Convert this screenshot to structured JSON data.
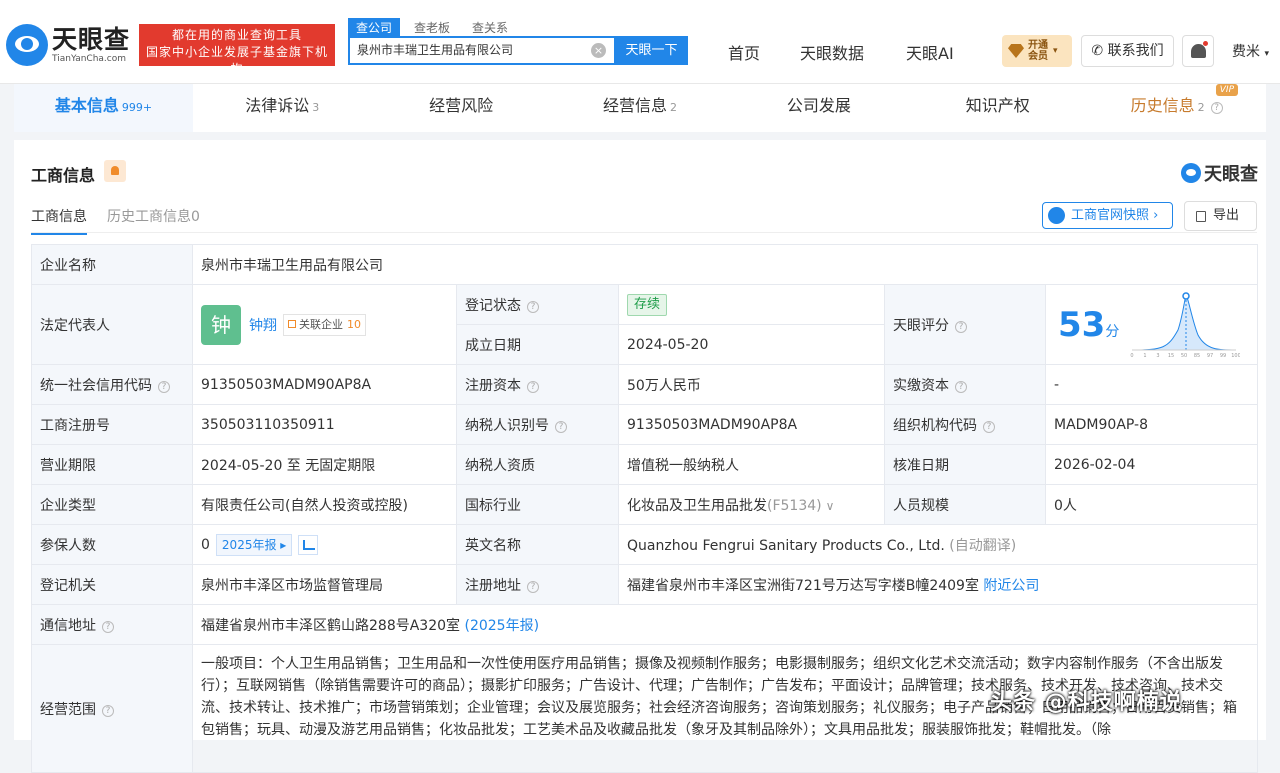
{
  "header": {
    "logo_cn": "天眼查",
    "logo_en": "TianYanCha.com",
    "slogan_line1": "都在用的商业查询工具",
    "slogan_line2": "国家中小企业发展子基金旗下机构",
    "search_tabs": [
      "查公司",
      "查老板",
      "查关系"
    ],
    "search_value": "泉州市丰瑞卫生用品有限公司",
    "search_button": "天眼一下",
    "nav": [
      "首页",
      "天眼数据",
      "天眼AI"
    ],
    "vip_line1": "开通",
    "vip_line2": "会员",
    "contact": "联系我们",
    "user": "费米"
  },
  "tabs": [
    {
      "label": "基本信息",
      "count": "999+"
    },
    {
      "label": "法律诉讼",
      "count": "3"
    },
    {
      "label": "经营风险",
      "count": ""
    },
    {
      "label": "经营信息",
      "count": "2"
    },
    {
      "label": "公司发展",
      "count": ""
    },
    {
      "label": "知识产权",
      "count": ""
    },
    {
      "label": "历史信息",
      "count": "2",
      "badge": "VIP"
    }
  ],
  "section": {
    "title": "工商信息",
    "brand": "天眼查",
    "subtab_active": "工商信息",
    "subtab_history": "历史工商信息0",
    "site_btn": "工商官网快照",
    "export_btn": "导出"
  },
  "info": {
    "company_name_label": "企业名称",
    "company_name": "泉州市丰瑞卫生用品有限公司",
    "legal_label": "法定代表人",
    "legal_avatar": "钟",
    "legal_name": "钟翔",
    "related_label": "关联企业",
    "related_count": "10",
    "status_label": "登记状态",
    "status": "存续",
    "found_label": "成立日期",
    "found": "2024-05-20",
    "score_label": "天眼评分",
    "score": "53",
    "score_unit": "分",
    "credit_label": "统一社会信用代码",
    "credit": "91350503MADM90AP8A",
    "capital_label": "注册资本",
    "capital": "50万人民币",
    "paid_label": "实缴资本",
    "paid": "-",
    "regno_label": "工商注册号",
    "regno": "350503110350911",
    "taxid_label": "纳税人识别号",
    "taxid": "91350503MADM90AP8A",
    "org_label": "组织机构代码",
    "org": "MADM90AP-8",
    "term_label": "营业期限",
    "term": "2024-05-20 至 无固定期限",
    "taxq_label": "纳税人资质",
    "taxq": "增值税一般纳税人",
    "approve_label": "核准日期",
    "approve": "2026-02-04",
    "type_label": "企业类型",
    "type": "有限责任公司(自然人投资或控股)",
    "industry_label": "国标行业",
    "industry": "化妆品及卫生用品批发",
    "industry_code": "(F5134)",
    "staff_label": "人员规模",
    "staff": "0人",
    "insured_label": "参保人数",
    "insured": "0",
    "insured_year": "2025年报",
    "en_label": "英文名称",
    "en": "Quanzhou Fengrui Sanitary Products Co., Ltd.",
    "en_note": "(自动翻译)",
    "authority_label": "登记机关",
    "authority": "泉州市丰泽区市场监督管理局",
    "address_label": "注册地址",
    "address": "福建省泉州市丰泽区宝洲街721号万达写字楼B幢2409室",
    "nearby": "附近公司",
    "mail_label": "通信地址",
    "mail": "福建省泉州市丰泽区鹤山路288号A320室",
    "mail_year": "(2025年报)",
    "scope_label": "经营范围",
    "scope": "一般项目：个人卫生用品销售；卫生用品和一次性使用医疗用品销售；摄像及视频制作服务；电影摄制服务；组织文化艺术交流活动；数字内容制作服务（不含出版发行）；互联网销售（除销售需要许可的商品）；摄影扩印服务；广告设计、代理；广告制作；广告发布；平面设计；品牌管理；技术服务、技术开发、技术咨询、技术交流、技术转让、技术推广；市场营销策划；企业管理；会议及展览服务；社会经济咨询服务；咨询策划服务；礼仪服务；电子产品销售；日用品销售；日用百货销售；箱包销售；玩具、动漫及游艺用品销售；化妆品批发；工艺美术品及收藏品批发（象牙及其制品除外）；文具用品批发；服装服饰批发；鞋帽批发。（除"
  },
  "score_chart": {
    "x_ticks": [
      "0",
      "1",
      "3",
      "15",
      "50",
      "85",
      "97",
      "99",
      "100"
    ],
    "value": 53
  },
  "watermark": "头条 @科技啊楠说",
  "colors": {
    "accent": "#2186e8",
    "slogan_bg": "#e23a2e",
    "status_green": "#1f9d49"
  }
}
